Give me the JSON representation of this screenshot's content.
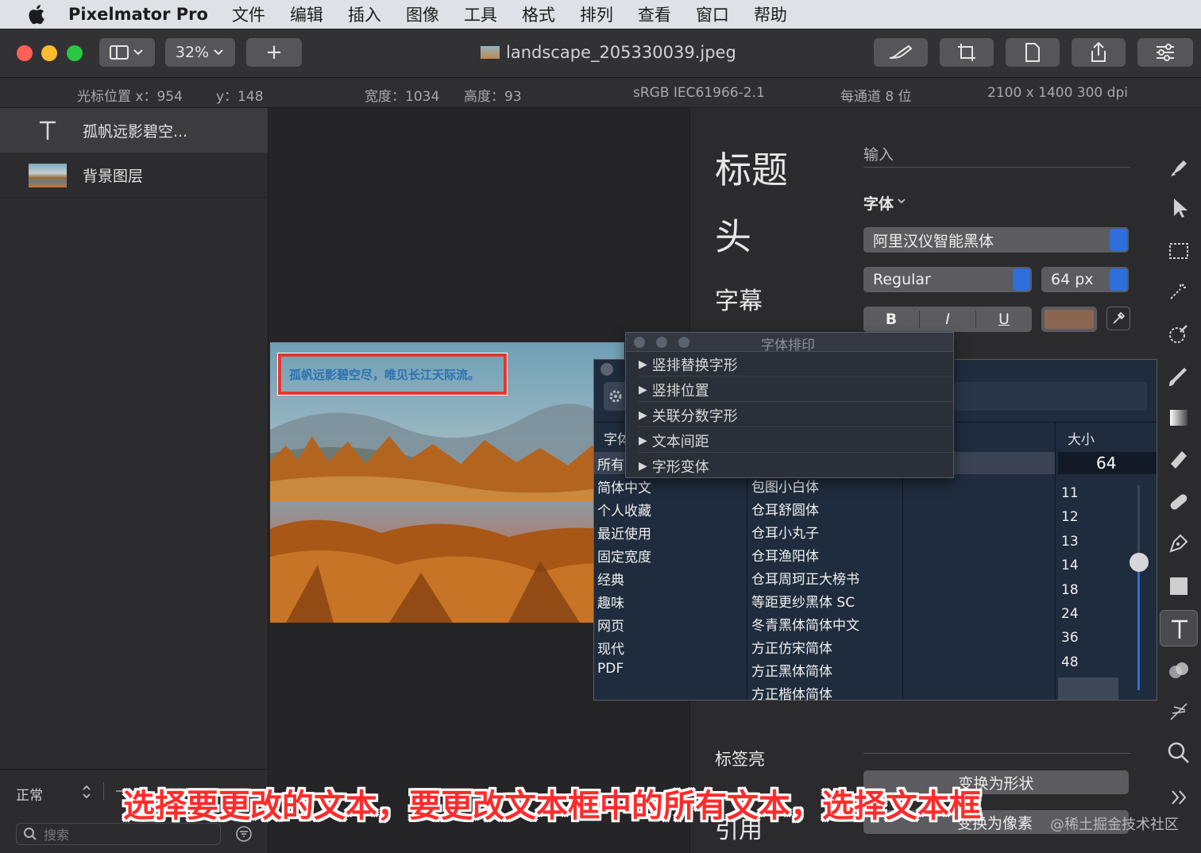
{
  "menubar": {
    "app_name": "Pixelmator Pro",
    "items": [
      "文件",
      "编辑",
      "插入",
      "图像",
      "工具",
      "格式",
      "排列",
      "查看",
      "窗口",
      "帮助"
    ]
  },
  "toolbar": {
    "zoom": "32%",
    "add_label": "+",
    "document_title": "landscape_205330039.jpeg"
  },
  "infobar": {
    "cursor_x": "光标位置 x：954",
    "cursor_y": "y：148",
    "width": "宽度：1034",
    "height": "高度：93",
    "color_profile": "sRGB IEC61966-2.1",
    "bit_depth": "每通道 8 位",
    "dimensions": "2100 x 1400 300 dpi"
  },
  "layers": {
    "items": [
      {
        "name": "孤帆远影碧空...",
        "icon": "text-icon"
      },
      {
        "name": "背景图层",
        "icon": "image-thumbnail"
      }
    ],
    "blend_mode": "正常",
    "search_placeholder": "搜索"
  },
  "canvas": {
    "photo_text": "孤帆远影碧空尽，唯见长江天际流。",
    "selection_color": "#e8352c"
  },
  "inspector": {
    "styles": [
      "标题",
      "头",
      "字幕"
    ],
    "input_label": "输入",
    "font_section_label": "字体",
    "font_family": "阿里汉仪智能黑体",
    "font_style": "Regular",
    "font_size": "64 px",
    "bold": "B",
    "italic": "I",
    "underline": "U",
    "text_color": "#8c6551",
    "bottom_style": "标签亮",
    "cut_style": "引用",
    "convert_shape": "变换为形状",
    "convert_pixels": "变换为像素"
  },
  "typography_popup": {
    "title": "字体排印",
    "items": [
      "竖排替换字形",
      "竖排位置",
      "关联分数字形",
      "文本间距",
      "字形变体"
    ]
  },
  "fonts_panel": {
    "family_header_partial": "字体",
    "size_header": "大小",
    "size_value": "64",
    "collections": [
      "所有",
      "简体中文",
      "个人收藏",
      "最近使用",
      "固定宽度",
      "经典",
      "趣味",
      "网页",
      "现代",
      "PDF"
    ],
    "families": [
      "包图小白体",
      "仓耳舒圆体",
      "仓耳小丸子",
      "仓耳渔阳体",
      "仓耳周珂正大榜书",
      "等距更纱黑体 SC",
      "冬青黑体简体中文",
      "方正仿宋简体",
      "方正黑体简体",
      "方正楷体简体"
    ],
    "sizes": [
      "11",
      "12",
      "13",
      "14",
      "18",
      "24",
      "36",
      "48",
      "64"
    ]
  },
  "caption": "选择要更改的文本，要更改文本框中的所有文本，选择文本框",
  "watermark": "@稀土掘金技术社区",
  "colors": {
    "accent": "#2f6fdb",
    "close": "#fe5f57",
    "minimize": "#febc2e",
    "zoom": "#28c840"
  }
}
